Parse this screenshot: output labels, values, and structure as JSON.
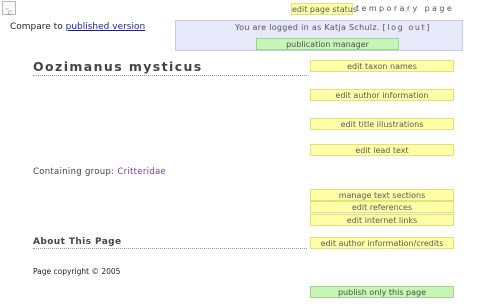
{
  "header": {
    "edit_page_status": "edit page status",
    "temporary_page": "temporary page",
    "compare_prefix": "Compare to",
    "compare_link": "published version"
  },
  "login": {
    "text_prefix": "You are logged in as Katja Schulz.",
    "logout_label": "[log out]",
    "publication_manager": "publication manager"
  },
  "page": {
    "title": "Oozimanus mysticus",
    "containing_label": "Containing group:",
    "containing_group": "Critteridae",
    "about_heading": "About This Page",
    "copyright": "Page copyright © 2005"
  },
  "buttons": {
    "edit_taxon_names": "edit taxon names",
    "edit_author_information": "edit author information",
    "edit_title_illustrations": "edit title illustrations",
    "edit_lead_text": "edit lead text",
    "manage_text_sections": "manage text sections",
    "edit_references": "edit references",
    "edit_internet_links": "edit internet links",
    "edit_author_credits": "edit author information/credits",
    "publish_only_this_page": "publish only this page"
  },
  "icons": {
    "corner_icon": "temporary-page-icon"
  },
  "colors": {
    "yellow_button": "#ffffa8",
    "green_button": "#c6f5b6",
    "login_panel": "#e8e8fb",
    "link_blue": "#1a1ab0",
    "group_purple": "#7a3aa8"
  }
}
